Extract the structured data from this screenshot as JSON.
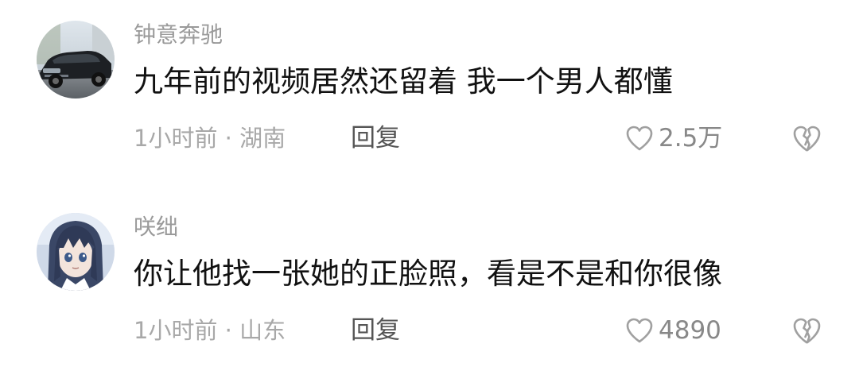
{
  "comments": [
    {
      "username": "钟意奔驰",
      "avatar": "car-avatar",
      "text": "九年前的视频居然还留着 我一个男人都懂",
      "meta": "1小时前 · 湖南",
      "reply_label": "回复",
      "like_count": "2.5万"
    },
    {
      "username": "咲绌",
      "avatar": "anime-girl-avatar",
      "text": "你让他找一张她的正脸照，看是不是和你很像",
      "meta": "1小时前 · 山东",
      "reply_label": "回复",
      "like_count": "4890"
    }
  ],
  "icons": {
    "like": "heart-outline-icon",
    "dislike": "broken-heart-icon"
  },
  "colors": {
    "username": "#9a9a9a",
    "content": "#111111",
    "meta": "#a8a8a8",
    "reply": "#555555",
    "icon": "#a0a0a0"
  }
}
